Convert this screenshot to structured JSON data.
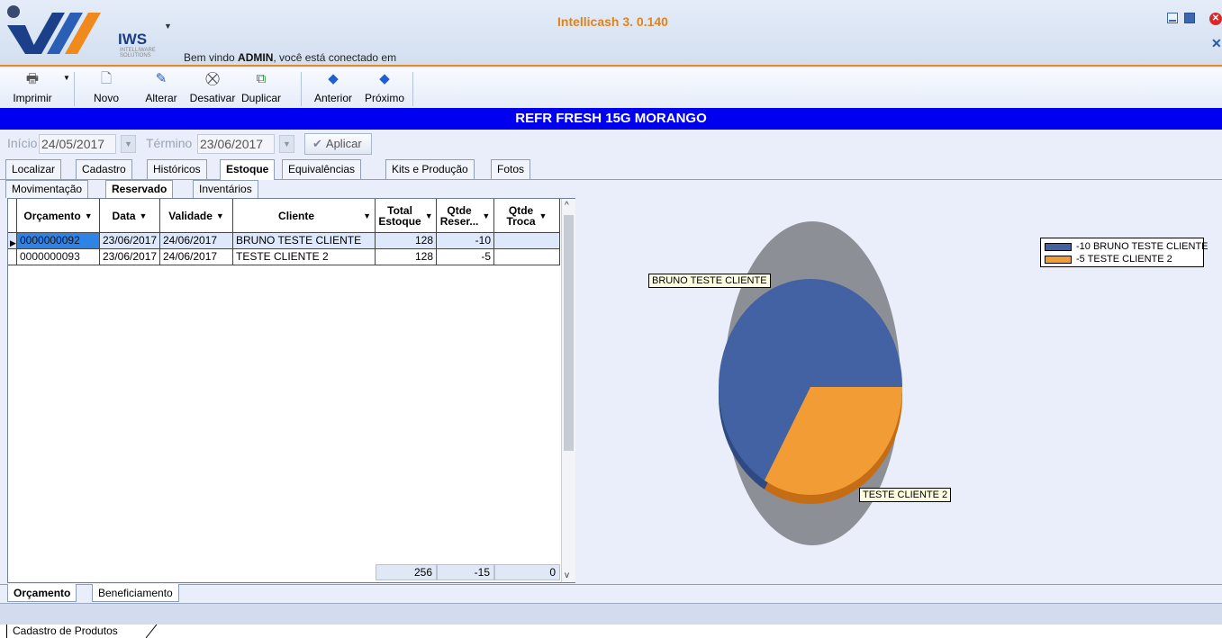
{
  "window": {
    "title": "Intellicash 3. 0.140",
    "brand": "IWS",
    "brand_sub": "INTELLIWARE SOLUTIONS",
    "welcome_prefix": "Bem vindo ",
    "welcome_user": "ADMIN",
    "welcome_suffix": ", você está conectado em"
  },
  "toolbar": {
    "print_label": "Imprimir",
    "new_label": "Novo",
    "edit_label": "Alterar",
    "deactivate_label": "Desativar",
    "duplicate_label": "Duplicar",
    "previous_label": "Anterior",
    "next_label": "Próximo"
  },
  "product": {
    "title": "REFR FRESH 15G MORANGO"
  },
  "filter": {
    "start_label": "Início",
    "start_value": "24/05/2017",
    "end_label": "Término",
    "end_value": "23/06/2017",
    "apply_label": "Aplicar"
  },
  "tabs_main": [
    "Localizar",
    "Cadastro",
    "Históricos",
    "Estoque",
    "Equivalências",
    "Kits e Produção",
    "Fotos"
  ],
  "tabs_sub": [
    "Movimentação",
    "Reservado",
    "Inventários"
  ],
  "grid": {
    "columns": [
      "Orçamento",
      "Data",
      "Validade",
      "Cliente",
      "Total Estoque",
      "Qtde Reser...",
      "Qtde Troca"
    ],
    "col_total_l1": "Total",
    "col_total_l2": "Estoque",
    "col_reser_l1": "Qtde",
    "col_reser_l2": "Reser...",
    "col_troca_l1": "Qtde",
    "col_troca_l2": "Troca",
    "rows": [
      {
        "orcamento": "0000000092",
        "data": "23/06/2017",
        "validade": "24/06/2017",
        "cliente": "BRUNO TESTE CLIENTE",
        "total": "128",
        "reser": "-10",
        "troca": ""
      },
      {
        "orcamento": "0000000093",
        "data": "23/06/2017",
        "validade": "24/06/2017",
        "cliente": "TESTE CLIENTE 2",
        "total": "128",
        "reser": "-5",
        "troca": ""
      }
    ],
    "totals": {
      "total": "256",
      "reser": "-15",
      "troca": "0"
    }
  },
  "chart_data": {
    "type": "pie",
    "categories": [
      "BRUNO TESTE CLIENTE",
      "TESTE CLIENTE 2"
    ],
    "values": [
      -10,
      -5
    ],
    "legend": [
      "-10 BRUNO TESTE CLIENTE",
      "-5 TESTE CLIENTE 2"
    ],
    "legend_position": "top-right",
    "colors": [
      "#4362a3",
      "#f29c36"
    ]
  },
  "tabs_bottom": [
    "Orçamento",
    "Beneficiamento"
  ],
  "statusbar": {
    "tab_label": "Cadastro de Produtos"
  }
}
